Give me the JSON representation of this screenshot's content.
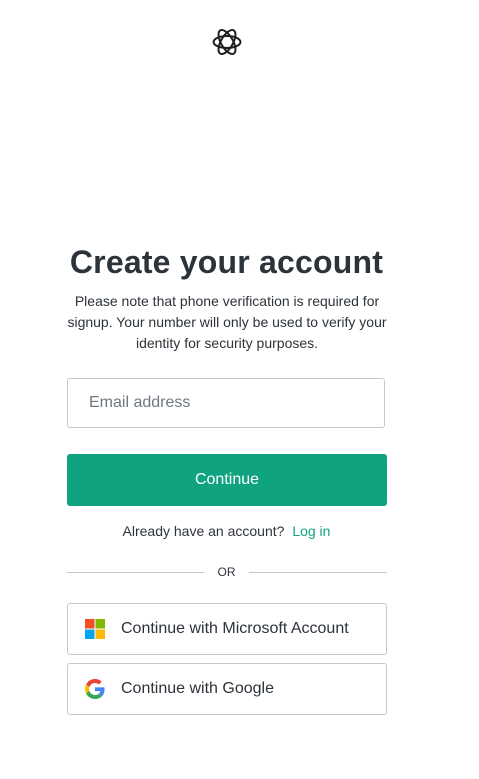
{
  "header": {
    "logo_icon": "openai-logo-icon"
  },
  "main": {
    "title": "Create your account",
    "subtitle": "Please note that phone verification is required for signup. Your number will only be used to verify your identity for security purposes.",
    "email_placeholder": "Email address",
    "email_value": "",
    "continue_label": "Continue",
    "login_prompt": "Already have an account?",
    "login_link": "Log in",
    "divider_text": "OR"
  },
  "social": {
    "microsoft_label": "Continue with Microsoft Account",
    "microsoft_icon": "microsoft-logo-icon",
    "google_label": "Continue with Google",
    "google_icon": "google-logo-icon"
  },
  "colors": {
    "accent": "#10a37f",
    "text": "#2d333a",
    "border": "#c2c8d0"
  }
}
